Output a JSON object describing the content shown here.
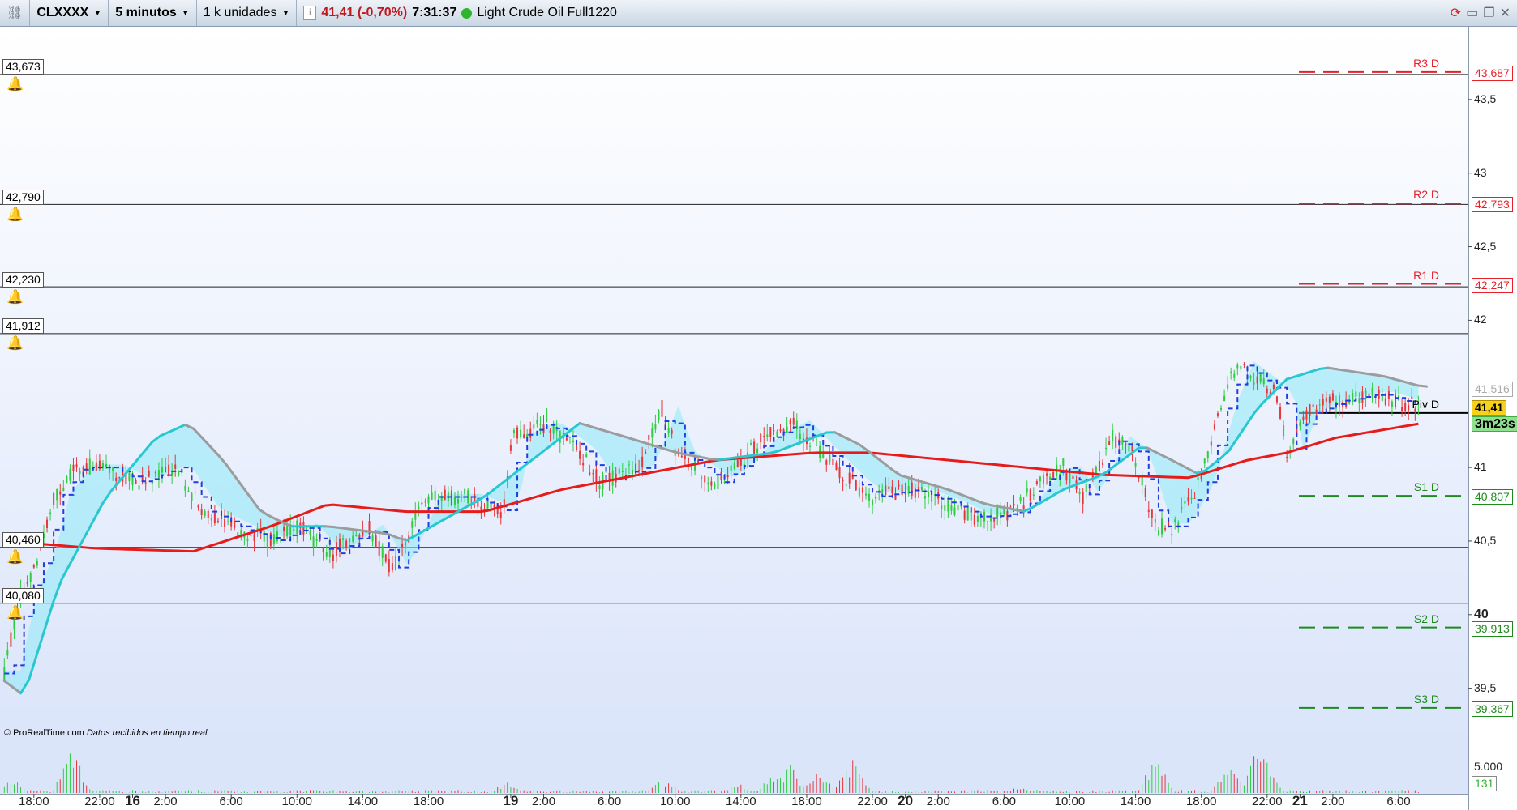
{
  "toolbar": {
    "symbol": "CLXXXX",
    "timeframe": "5 minutos",
    "units": "1 k unidades",
    "price": "41,41 (-0,70%)",
    "time": "7:31:37",
    "instrument": "Light Crude Oil Full1220",
    "status_color": "#2db52d"
  },
  "levels": [
    {
      "label": "43,673",
      "price": 43.673
    },
    {
      "label": "42,790",
      "price": 42.79
    },
    {
      "label": "42,230",
      "price": 42.23
    },
    {
      "label": "41,912",
      "price": 41.912
    },
    {
      "label": "40,460",
      "price": 40.46
    },
    {
      "label": "40,080",
      "price": 40.08
    }
  ],
  "pivots": [
    {
      "name": "R3 D",
      "value": "43,687",
      "price": 43.687,
      "color": "#e8202a"
    },
    {
      "name": "R2 D",
      "value": "42,793",
      "price": 42.793,
      "color": "#e8202a"
    },
    {
      "name": "R1 D",
      "value": "42,247",
      "price": 42.247,
      "color": "#e8202a"
    },
    {
      "name": "Piv D",
      "value": "",
      "price": 41.37,
      "color": "#000000"
    },
    {
      "name": "S1 D",
      "value": "40,807",
      "price": 40.807,
      "color": "#1e8a1e"
    },
    {
      "name": "S2 D",
      "value": "39,913",
      "price": 39.913,
      "color": "#1e8a1e"
    },
    {
      "name": "S3 D",
      "value": "39,367",
      "price": 39.367,
      "color": "#1e8a1e"
    }
  ],
  "price_axis": {
    "ticks": [
      {
        "label": "43,5",
        "v": 43.5
      },
      {
        "label": "43",
        "v": 43
      },
      {
        "label": "42,5",
        "v": 42.5
      },
      {
        "label": "42",
        "v": 42
      },
      {
        "label": "41",
        "v": 41
      },
      {
        "label": "40,5",
        "v": 40.5
      },
      {
        "label": "40",
        "v": 40
      },
      {
        "label": "39,5",
        "v": 39.5
      }
    ],
    "last_price": "41,41",
    "timer": "3m23s",
    "hidden_box": "41,516"
  },
  "volume_axis": {
    "tick": "5.000",
    "last": "131"
  },
  "credit": {
    "brand": "© ProRealTime.com",
    "note": "Datos recibidos en tiempo real"
  },
  "chart_data": {
    "type": "candlestick",
    "time_ticks": [
      {
        "t": 0,
        "label": "18:00"
      },
      {
        "t": 4,
        "label": "22:00"
      },
      {
        "t": 6,
        "label": "16",
        "day": true
      },
      {
        "t": 8,
        "label": "2:00"
      },
      {
        "t": 12,
        "label": "6:00"
      },
      {
        "t": 16,
        "label": "10:00"
      },
      {
        "t": 20,
        "label": "14:00"
      },
      {
        "t": 24,
        "label": "18:00"
      },
      {
        "t": 29,
        "label": "19",
        "day": true
      },
      {
        "t": 31,
        "label": "2:00"
      },
      {
        "t": 35,
        "label": "6:00"
      },
      {
        "t": 39,
        "label": "10:00"
      },
      {
        "t": 43,
        "label": "14:00"
      },
      {
        "t": 47,
        "label": "18:00"
      },
      {
        "t": 51,
        "label": "22:00"
      },
      {
        "t": 53,
        "label": "20",
        "day": true
      },
      {
        "t": 55,
        "label": "2:00"
      },
      {
        "t": 59,
        "label": "6:00"
      },
      {
        "t": 63,
        "label": "10:00"
      },
      {
        "t": 67,
        "label": "14:00"
      },
      {
        "t": 71,
        "label": "18:00"
      },
      {
        "t": 75,
        "label": "22:00"
      },
      {
        "t": 77,
        "label": "21",
        "day": true
      },
      {
        "t": 79,
        "label": "2:00"
      },
      {
        "t": 83,
        "label": "6:00"
      }
    ],
    "price_path": [
      [
        -1.8,
        39.6
      ],
      [
        -0.9,
        40.1
      ],
      [
        0.3,
        40.4
      ],
      [
        1.2,
        40.8
      ],
      [
        2.6,
        41.0
      ],
      [
        4.4,
        41.0
      ],
      [
        6.2,
        40.9
      ],
      [
        8.5,
        41.0
      ],
      [
        10.3,
        40.7
      ],
      [
        12.1,
        40.6
      ],
      [
        14.4,
        40.5
      ],
      [
        16.2,
        40.6
      ],
      [
        17.9,
        40.4
      ],
      [
        20.3,
        40.6
      ],
      [
        21.8,
        40.3
      ],
      [
        22.6,
        40.5
      ],
      [
        23.8,
        40.8
      ],
      [
        26.2,
        40.8
      ],
      [
        28.5,
        40.7
      ],
      [
        29.1,
        41.2
      ],
      [
        30.9,
        41.3
      ],
      [
        33.2,
        41.1
      ],
      [
        34.4,
        40.9
      ],
      [
        36.8,
        41.0
      ],
      [
        38.2,
        41.4
      ],
      [
        39.1,
        41.1
      ],
      [
        41.5,
        40.9
      ],
      [
        42.6,
        41.0
      ],
      [
        44.4,
        41.2
      ],
      [
        46.2,
        41.3
      ],
      [
        47.9,
        41.1
      ],
      [
        49.7,
        40.9
      ],
      [
        50.9,
        40.8
      ],
      [
        53.2,
        40.85
      ],
      [
        55.6,
        40.75
      ],
      [
        57.4,
        40.65
      ],
      [
        59.7,
        40.7
      ],
      [
        61.5,
        40.95
      ],
      [
        62.6,
        41.0
      ],
      [
        63.8,
        40.8
      ],
      [
        65.6,
        41.2
      ],
      [
        66.8,
        41.1
      ],
      [
        68.2,
        40.6
      ],
      [
        69.4,
        40.6
      ],
      [
        70.9,
        40.9
      ],
      [
        72.1,
        41.4
      ],
      [
        73.2,
        41.7
      ],
      [
        74.4,
        41.6
      ],
      [
        75.6,
        41.5
      ],
      [
        76.2,
        41.1
      ],
      [
        77.1,
        41.35
      ],
      [
        79.1,
        41.45
      ],
      [
        81.5,
        41.5
      ],
      [
        84.4,
        41.4
      ]
    ],
    "ma_slow": [
      [
        -1.8,
        40.5
      ],
      [
        3.8,
        40.45
      ],
      [
        9.7,
        40.43
      ],
      [
        14.4,
        40.6
      ],
      [
        17.9,
        40.75
      ],
      [
        22.6,
        40.7
      ],
      [
        27.4,
        40.7
      ],
      [
        32.1,
        40.85
      ],
      [
        36.8,
        40.95
      ],
      [
        41.5,
        41.05
      ],
      [
        47.4,
        41.1
      ],
      [
        50.9,
        41.1
      ],
      [
        55.6,
        41.05
      ],
      [
        60.3,
        41.0
      ],
      [
        65.0,
        40.95
      ],
      [
        70.3,
        40.93
      ],
      [
        73.8,
        41.05
      ],
      [
        76.2,
        41.1
      ],
      [
        79.1,
        41.2
      ],
      [
        84.4,
        41.3
      ]
    ],
    "ma_fast": [
      [
        -1.8,
        39.55
      ],
      [
        -0.6,
        39.45
      ],
      [
        1.5,
        40.2
      ],
      [
        4.4,
        40.8
      ],
      [
        7.4,
        41.2
      ],
      [
        9.4,
        41.3
      ],
      [
        11.5,
        41.05
      ],
      [
        13.8,
        40.7
      ],
      [
        15.6,
        40.6
      ],
      [
        17.9,
        40.6
      ],
      [
        21.5,
        40.55
      ],
      [
        22.6,
        40.5
      ],
      [
        27.4,
        40.8
      ],
      [
        29.7,
        41.0
      ],
      [
        33.2,
        41.3
      ],
      [
        36.2,
        41.2
      ],
      [
        39.1,
        41.1
      ],
      [
        41.5,
        41.05
      ],
      [
        45.0,
        41.1
      ],
      [
        48.5,
        41.25
      ],
      [
        50.3,
        41.15
      ],
      [
        52.6,
        40.95
      ],
      [
        55.6,
        40.85
      ],
      [
        57.9,
        40.75
      ],
      [
        60.3,
        40.7
      ],
      [
        62.6,
        40.85
      ],
      [
        65.0,
        40.95
      ],
      [
        67.4,
        41.15
      ],
      [
        69.2,
        41.05
      ],
      [
        70.9,
        40.95
      ],
      [
        72.6,
        41.1
      ],
      [
        74.4,
        41.4
      ],
      [
        76.2,
        41.6
      ],
      [
        78.5,
        41.68
      ],
      [
        82.1,
        41.62
      ],
      [
        84.4,
        41.55
      ]
    ],
    "volume_spikes": [
      [
        -1.5,
        2500
      ],
      [
        2.3,
        6500
      ],
      [
        28.8,
        1800
      ],
      [
        38.3,
        2000
      ],
      [
        42.8,
        1500
      ],
      [
        45.0,
        3000
      ],
      [
        46.0,
        4000
      ],
      [
        47.7,
        3500
      ],
      [
        49.8,
        5500
      ],
      [
        60.0,
        1000
      ],
      [
        68.2,
        5000
      ],
      [
        72.7,
        3800
      ],
      [
        74.4,
        6800
      ],
      [
        74.8,
        6200
      ]
    ],
    "volume_max": 8000
  },
  "colors": {
    "up": "#2ecc40",
    "down": "#e8353b",
    "ma_slow": "#e81b1b",
    "ma_rise": "#27c8d0",
    "ma_fall": "#9c9c9c",
    "cloud": "#8eeaf7",
    "signal": "#1f3ee0"
  }
}
